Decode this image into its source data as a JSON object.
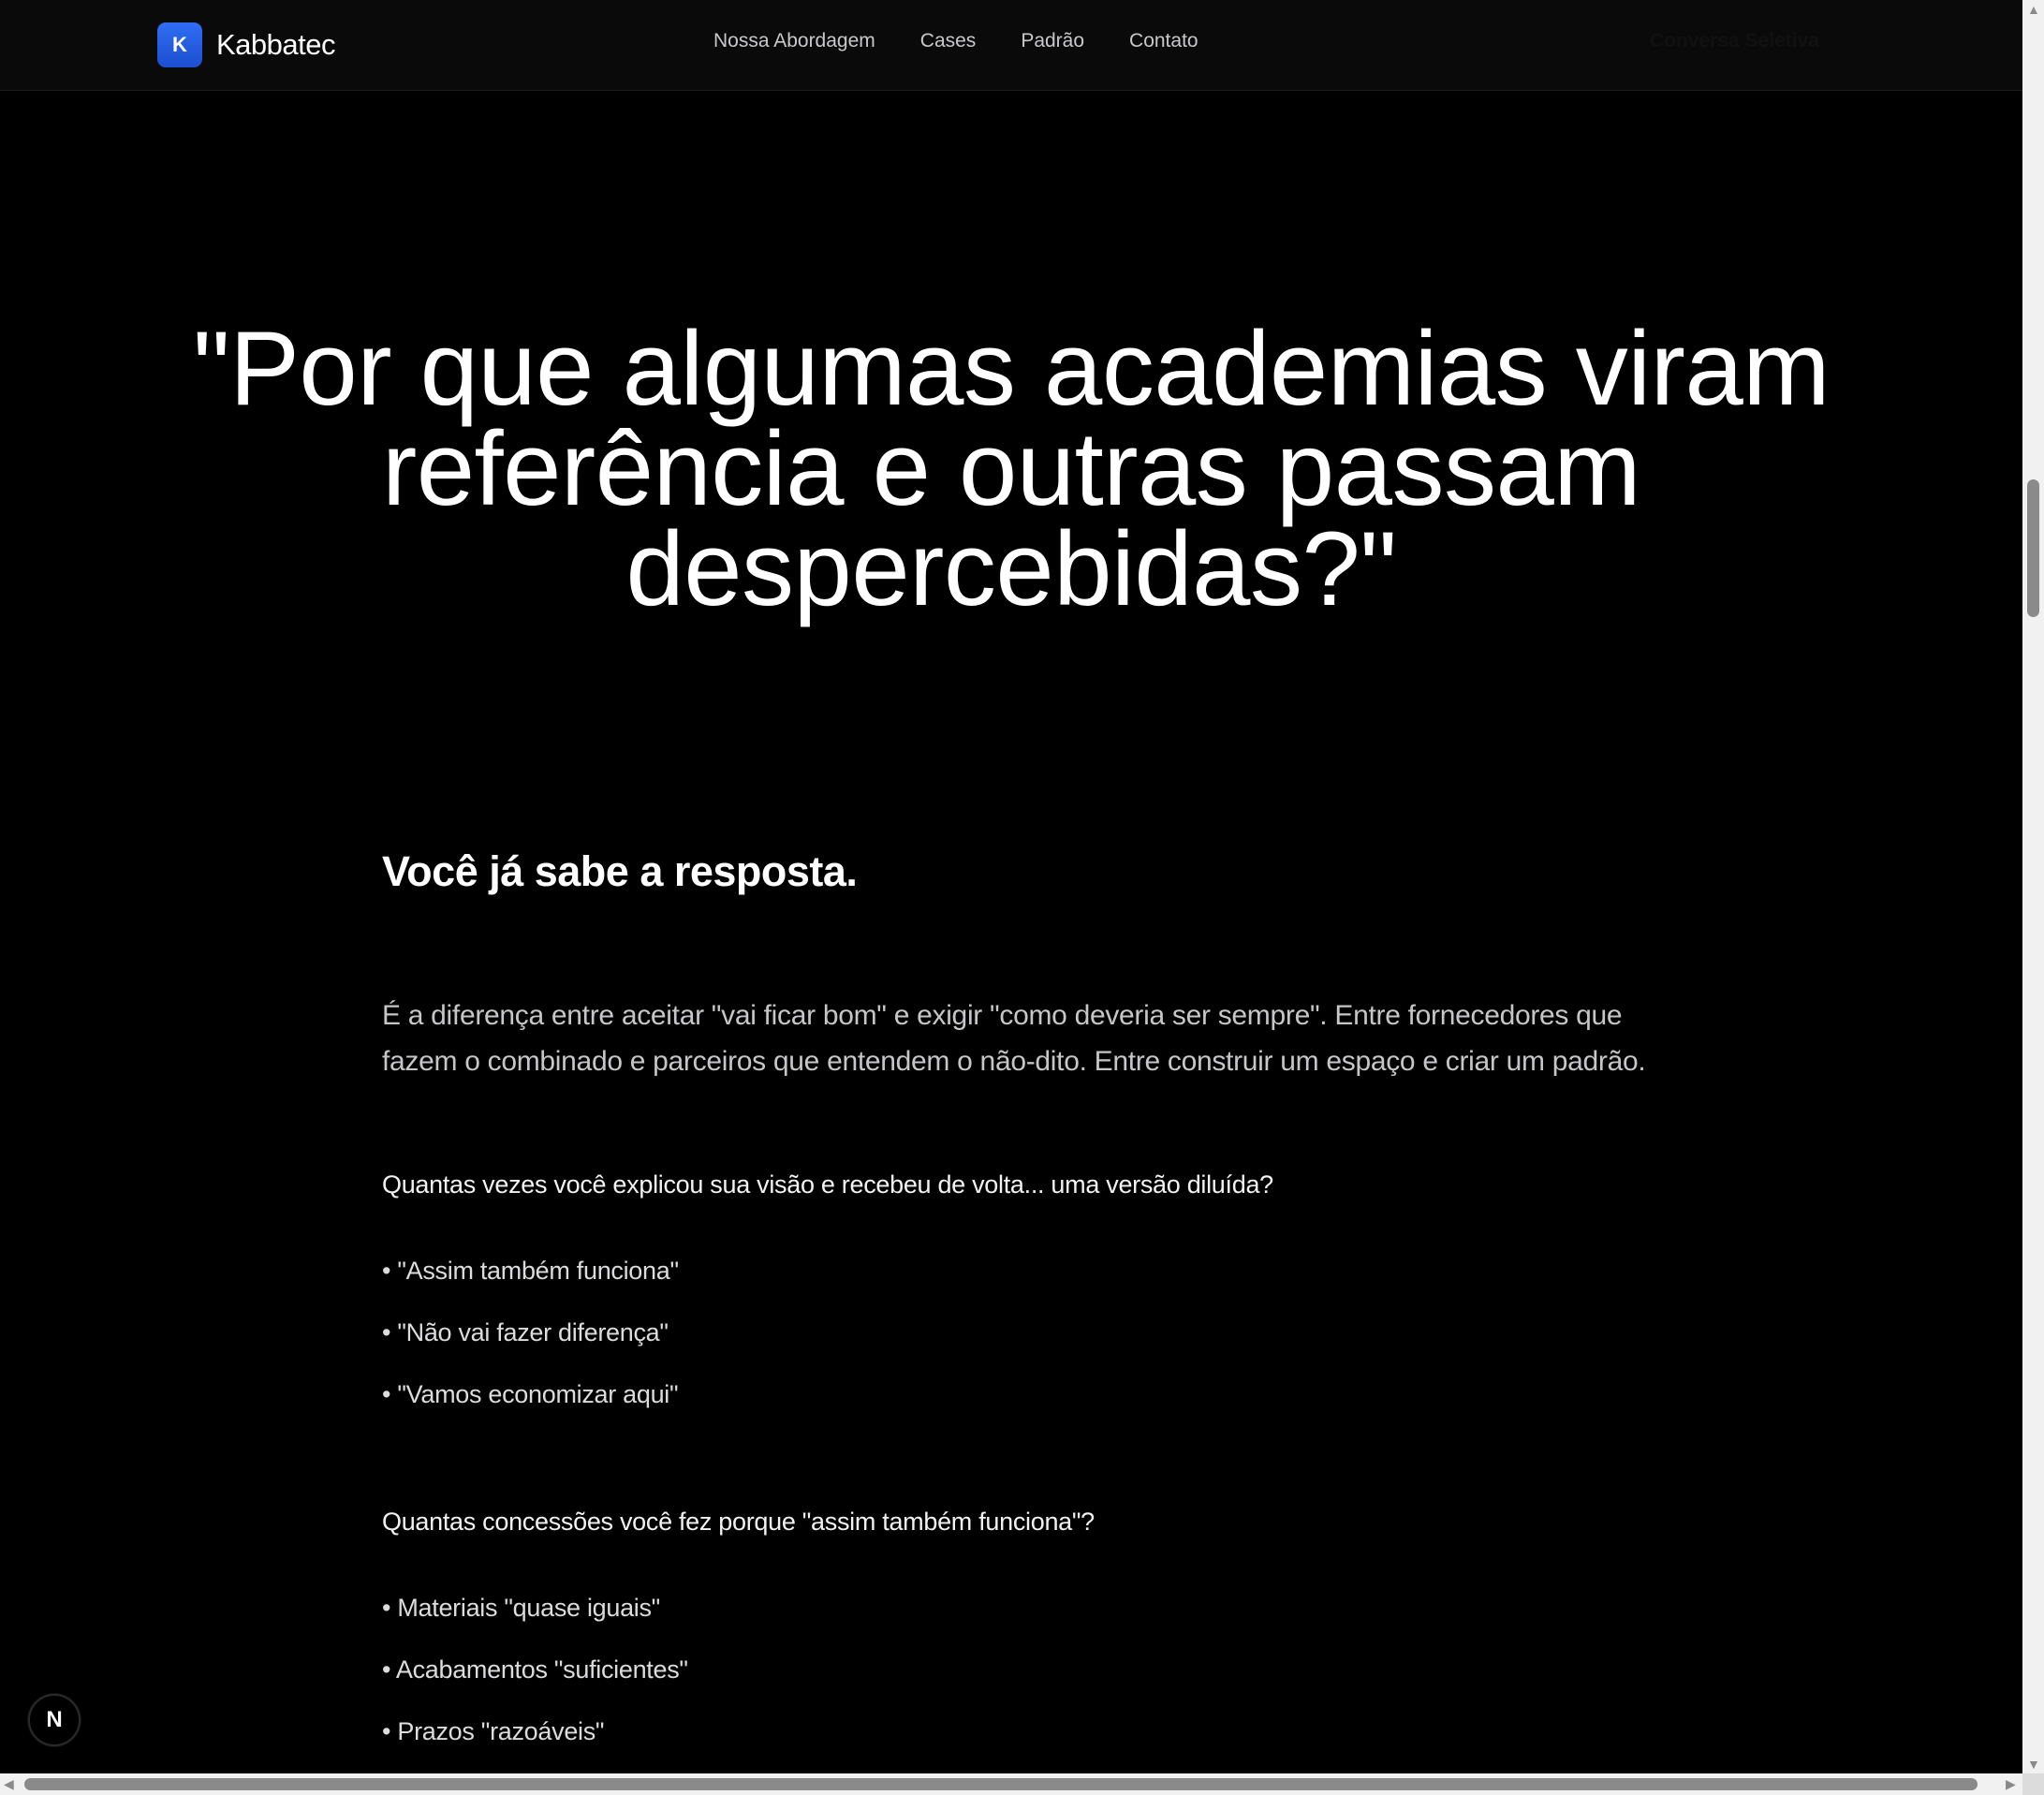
{
  "header": {
    "brand_letter": "K",
    "brand_name": "Kabbatec",
    "nav": [
      "Nossa Abordagem",
      "Cases",
      "Padrão",
      "Contato"
    ],
    "cta": "Conversa Seletiva"
  },
  "hero": {
    "line1": "\"Por que algumas academias viram",
    "line2": "referência e outras passam",
    "line3": "despercebidas?\""
  },
  "content": {
    "subhead": "Você já sabe a resposta.",
    "paragraph_line1": "É a diferença entre aceitar \"vai ficar bom\" e exigir \"como deveria ser sempre\". Entre fornecedores que",
    "paragraph_line2": "fazem o combinado e parceiros que entendem o não-dito. Entre construir um espaço e criar um padrão.",
    "question1": "Quantas vezes você explicou sua visão e recebeu de volta... uma versão diluída?",
    "list1": [
      "\"Assim também funciona\"",
      "\"Não vai fazer diferença\"",
      "\"Vamos economizar aqui\""
    ],
    "question2": "Quantas concessões você fez porque \"assim também funciona\"?",
    "list2": [
      "Materiais \"quase iguais\"",
      "Acabamentos \"suficientes\"",
      "Prazos \"razoáveis\""
    ]
  },
  "floating_badge": "N",
  "colors": {
    "accent": "#2f6df2",
    "background": "#000000",
    "nav_background": "#0a0a0b"
  }
}
